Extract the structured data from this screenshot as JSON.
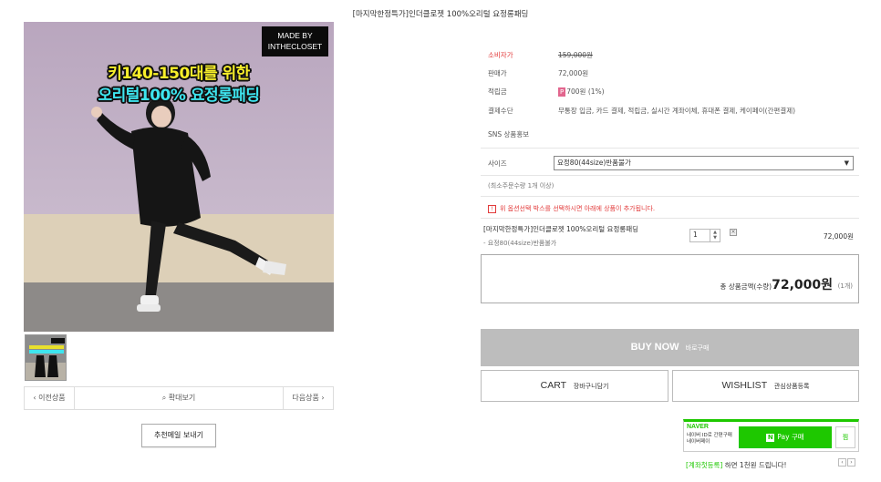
{
  "page_title": "[마지막한정특가]인더클로젯 100%오리털 요정롱패딩",
  "image": {
    "made_by_line1": "MADE BY",
    "made_by_line2": "INTHECLOSET",
    "headline_1": "키140-150대를 위한",
    "headline_2": "오리털100% 요정롱패딩"
  },
  "image_nav": {
    "prev": "‹ 이전상품",
    "zoom_icon": "magnifier-icon",
    "zoom": "확대보기",
    "next": "다음상품 ›"
  },
  "recommend_button": "추천메일 보내기",
  "info": {
    "consumer_price_label": "소비자가",
    "consumer_price": "159,000원",
    "sale_price_label": "판매가",
    "sale_price": "72,000원",
    "points_label": "적립금",
    "points_badge": "P",
    "points_value": "700원 (1%)",
    "payment_label": "결제수단",
    "payment_value": "무통장 입금, 카드 결제, 적립금, 실시간 계좌이체, 휴대폰 결제, 케이페이(간편결제)",
    "sns_label": "SNS 상품홍보"
  },
  "options": {
    "size_label": "사이즈",
    "size_selected": "요정80(44size)반품불가",
    "min_qty_note": "(최소주문수량 1개 이상)",
    "warning": "위 옵션선택 박스를 선택하시면 아래에 상품이 추가됩니다."
  },
  "selected_item": {
    "name": "[마지막한정특가]인더클로젯 100%오리털 요정롱패딩",
    "option": "- 요정80(44size)반품불가",
    "quantity": "1",
    "price": "72,000원"
  },
  "total": {
    "label": "총 상품금액(수량) :",
    "amount": "72,000원",
    "count": "(1개)"
  },
  "buttons": {
    "buy_main": "BUY NOW",
    "buy_sub": "바로구매",
    "cart_main": "CART",
    "cart_sub": "장바구니담기",
    "wish_main": "WISHLIST",
    "wish_sub": "관심상품등록"
  },
  "naver_pay": {
    "brand": "NAVER",
    "desc_1": "네이버 ID로 간편구매",
    "desc_2": "네이버페이",
    "pay_label": "Pay 구매",
    "pay_n": "N",
    "zzim": "찜",
    "promo_highlight": "[계좌첫등록]",
    "promo_text": " 하면 1천원 드립니다!"
  },
  "colors": {
    "accent_red": "#e23b3b",
    "naver_green": "#1ec800",
    "buy_button": "#bdbdbd"
  }
}
